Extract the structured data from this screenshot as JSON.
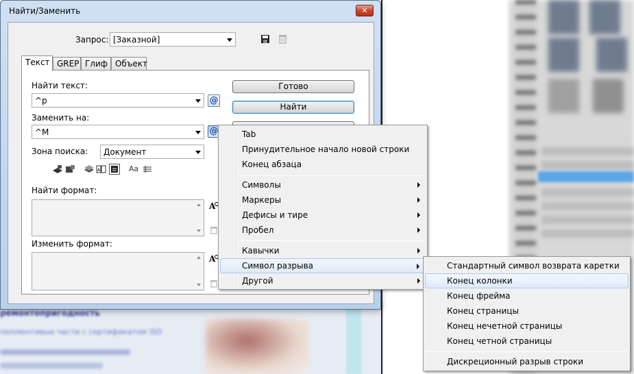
{
  "dialog": {
    "title": "Найти/Заменить",
    "close_label": "✕"
  },
  "query": {
    "label": "Запрос:",
    "value": "[Заказной]"
  },
  "tabs": [
    {
      "label": "Текст",
      "active": true
    },
    {
      "label": "GREP",
      "active": false
    },
    {
      "label": "Глиф",
      "active": false
    },
    {
      "label": "Объект",
      "active": false
    }
  ],
  "find": {
    "label": "Найти текст:",
    "value": "^p"
  },
  "replace": {
    "label": "Заменить на:",
    "value": "^M"
  },
  "scope": {
    "label": "Зона поиска:",
    "value": "Документ"
  },
  "find_format": {
    "label": "Найти формат:"
  },
  "change_format": {
    "label": "Изменить формат:"
  },
  "buttons": {
    "done": "Готово",
    "find": "Найти"
  },
  "icons": {
    "at": "@",
    "aa": "Aa"
  },
  "menu": {
    "items": [
      {
        "label": "Tab",
        "submenu": false
      },
      {
        "label": "Принудительное начало новой строки",
        "submenu": false
      },
      {
        "label": "Конец абзаца",
        "submenu": false
      },
      {
        "label": "Символы",
        "submenu": true
      },
      {
        "label": "Маркеры",
        "submenu": true
      },
      {
        "label": "Дефисы и тире",
        "submenu": true
      },
      {
        "label": "Пробел",
        "submenu": true
      },
      {
        "label": "Кавычки",
        "submenu": true
      },
      {
        "label": "Символ разрыва",
        "submenu": true,
        "highlighted": true
      },
      {
        "label": "Другой",
        "submenu": true
      }
    ]
  },
  "submenu": {
    "items": [
      {
        "label": "Стандартный символ возврата каретки"
      },
      {
        "label": "Конец колонки",
        "highlighted": true
      },
      {
        "label": "Конец фрейма"
      },
      {
        "label": "Конец страницы"
      },
      {
        "label": "Конец нечетной страницы"
      },
      {
        "label": "Конец четной страницы"
      },
      {
        "label": "Дискреционный разрыв строки"
      }
    ]
  },
  "background": {
    "blurred_text_1": "ремонтопригодность",
    "blurred_text_2": "поллюнтивые части с сертификатом ISO"
  }
}
